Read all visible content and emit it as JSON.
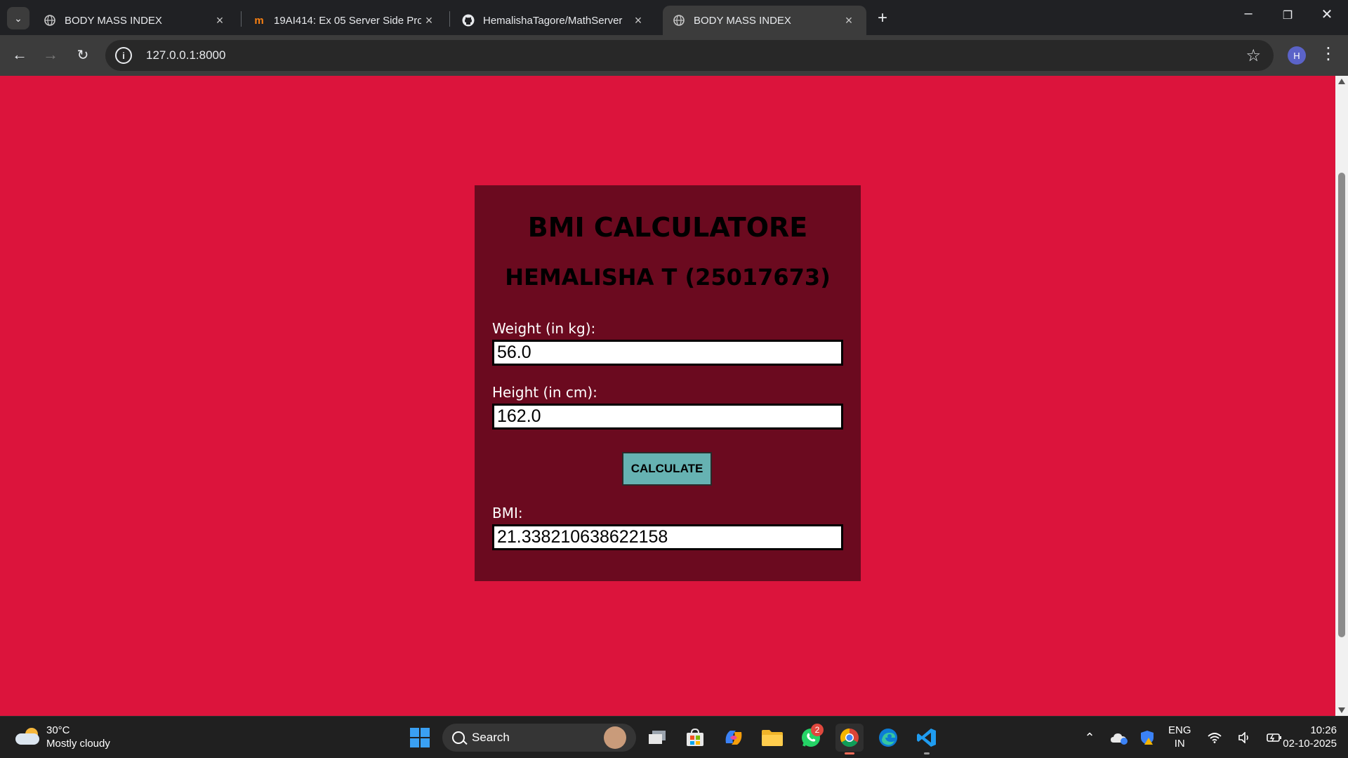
{
  "browser": {
    "tabs": [
      {
        "title": "BODY MASS INDEX",
        "active": false
      },
      {
        "title": "19AI414: Ex 05 Server Side Proc",
        "active": false
      },
      {
        "title": "HemalishaTagore/MathServer",
        "active": false
      },
      {
        "title": "BODY MASS INDEX",
        "active": true
      }
    ],
    "url": "127.0.0.1:8000",
    "profile_initial": "H"
  },
  "page": {
    "background": "#dc143c",
    "card_color": "#6b0a1f",
    "title": "BMI CALCULATORE",
    "subtitle": "HEMALISHA T (25017673)",
    "weight_label": "Weight (in kg):",
    "weight_value": "56.0",
    "height_label": "Height (in cm):",
    "height_value": "162.0",
    "calculate_label": "CALCULATE",
    "bmi_label": "BMI:",
    "bmi_value": "21.338210638622158",
    "button_color": "#66b2b2"
  },
  "taskbar": {
    "weather_temp": "30°C",
    "weather_desc": "Mostly cloudy",
    "search_label": "Search",
    "whatsapp_badge": "2",
    "lang_line1": "ENG",
    "lang_line2": "IN",
    "time": "10:26",
    "date": "02-10-2025"
  }
}
